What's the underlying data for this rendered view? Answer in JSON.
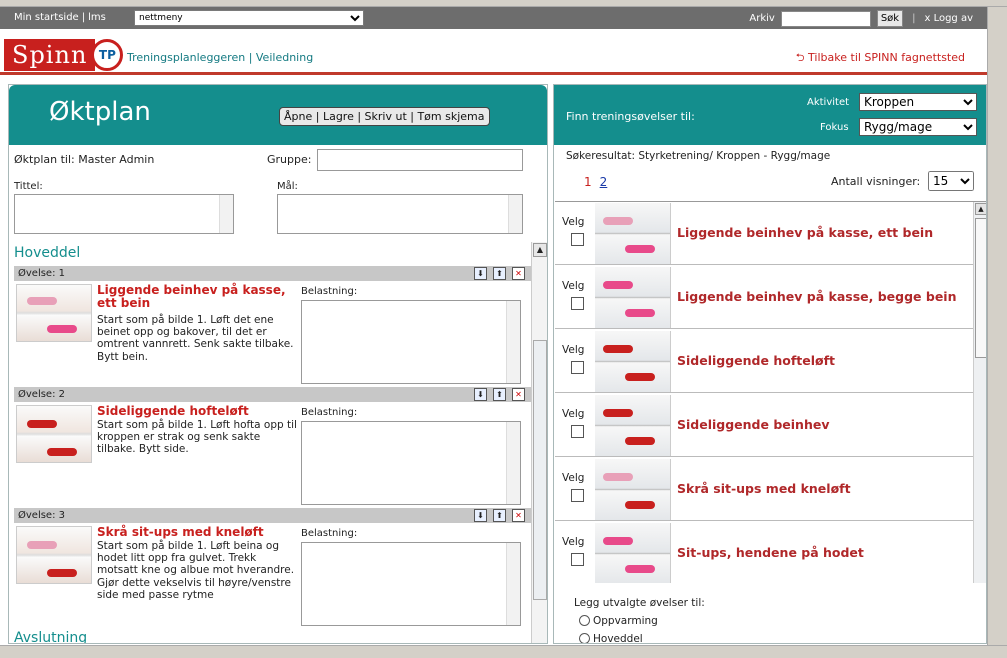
{
  "topbar": {
    "min_startside": "Min startside",
    "lms": "lms",
    "dropdown_value": "nettmeny",
    "arkiv": "Arkiv",
    "search_button": "Søk",
    "logout": "x Logg av"
  },
  "header": {
    "logo_text": "Spinn",
    "logo_badge": "TP",
    "links": "Treningsplanleggeren | Veiledning",
    "back_link": "Tilbake til SPINN fagnettsted"
  },
  "left": {
    "title": "Øktplan",
    "toolbar": "Åpne | Lagre | Skriv ut | Tøm skjema",
    "plan_for": "Øktplan til: Master Admin",
    "gruppe_label": "Gruppe:",
    "tittel_label": "Tittel:",
    "maal_label": "Mål:",
    "section_hoveddel": "Hoveddel",
    "section_avslutning": "Avslutning",
    "belastning_label": "Belastning:",
    "exercises": [
      {
        "header": "Øvelse: 1",
        "title": "Liggende beinhev på kasse, ett bein",
        "desc": "Start som på bilde 1. Løft det ene beinet opp og bakover, til det er omtrent vannrett. Senk sakte tilbake. Bytt bein."
      },
      {
        "header": "Øvelse: 2",
        "title": "Sideliggende hofteløft",
        "desc": "Start som på bilde 1. Løft hofta opp til kroppen er strak og senk sakte tilbake. Bytt side."
      },
      {
        "header": "Øvelse: 3",
        "title": "Skrå sit-ups med kneløft",
        "desc": "Start som på bilde 1. Løft beina og hodet litt opp fra gulvet. Trekk motsatt kne og albue mot hverandre. Gjør dette vekselvis til høyre/venstre side med passe rytme"
      }
    ]
  },
  "right": {
    "finn_label": "Finn treningsøvelser til:",
    "aktivitet_label": "Aktivitet",
    "aktivitet_value": "Kroppen",
    "fokus_label": "Fokus",
    "fokus_value": "Rygg/mage",
    "sokeresultat": "Søkeresultat:  Styrketrening/ Kroppen  -  Rygg/mage",
    "page1": "1",
    "page2": "2",
    "antall_label": "Antall visninger:",
    "antall_value": "15",
    "velg_label": "Velg",
    "results": [
      "Liggende beinhev på kasse, ett bein",
      "Liggende beinhev på kasse, begge bein",
      "Sideliggende hofteløft",
      "Sideliggende beinhev",
      "Skrå sit-ups med kneløft",
      "Sit-ups, hendene på hodet"
    ],
    "legg_label": "Legg utvalgte øvelser til:",
    "radio_options": [
      "Oppvarming",
      "Hoveddel"
    ]
  }
}
